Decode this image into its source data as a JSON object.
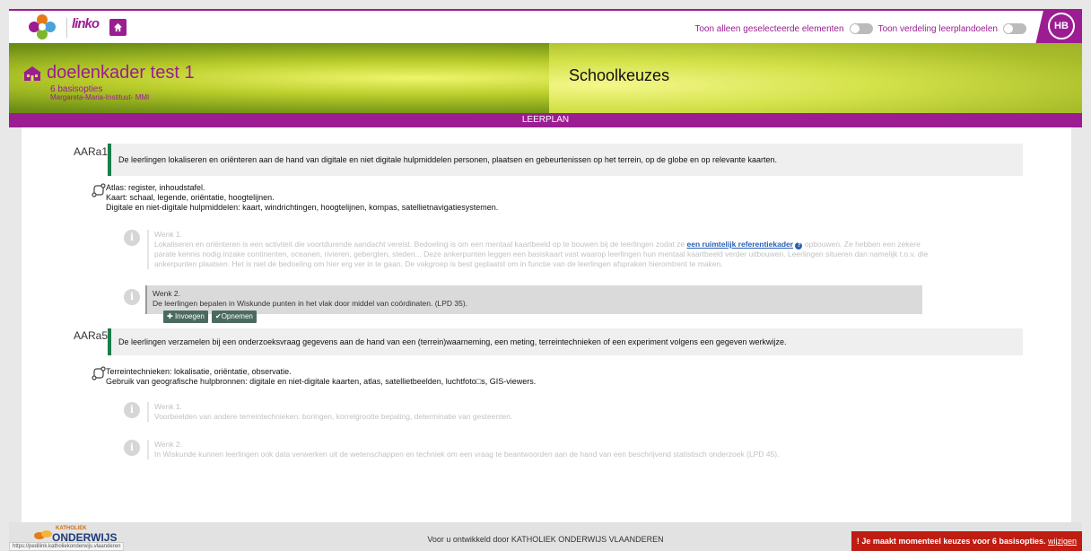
{
  "topbar": {
    "brand": "linko",
    "toggle_selected_label": "Toon alleen geselecteerde elementen",
    "toggle_distribution_label": "Toon verdeling leerplandoelen",
    "avatar_initials": "HB"
  },
  "hero": {
    "title": "doelenkader test 1",
    "subtitle": "6 basisopties",
    "school": "Margareta-Maria-Instituut- MMI",
    "section_title": "Schoolkeuzes"
  },
  "band": {
    "label": "LEERPLAN"
  },
  "goals": [
    {
      "code": "AARa1",
      "text": "De leerlingen lokaliseren en oriënteren aan de hand van digitale en niet digitale hulpmiddelen personen, plaatsen en gebeurtenissen op het terrein, op de globe en op relevante kaarten.",
      "details": [
        "Atlas: register, inhoudstafel.",
        "Kaart: schaal, legende, oriëntatie, hoogtelijnen.",
        "Digitale en niet-digitale hulpmiddelen: kaart, windrichtingen, hoogtelijnen, kompas, satellietnavigatiesystemen."
      ],
      "wenken": [
        {
          "title": "Wenk 1.",
          "text_before": "Lokaliseren en oriënteren is een activiteit die voortdurende aandacht vereist. Bedoeling is om een mentaal kaartbeeld op te bouwen bij de leerlingen zodat ze ",
          "link": "een ruimtelijk referentiekader",
          "text_after": " opbouwen.  Ze hebben een zekere parate kennis nodig inzake continenten, oceanen, rivieren, gebergten, steden... Deze ankerpunten leggen een basiskaart vast waarop leerlingen hun mentaal kaartbeeld verder uitbouwen. Leerlingen situeren dan namelijk t.o.v. die ankerpunten plaatsen. Het is niet de bedoeling om hier erg ver in te gaan. De vakgroep is best geplaatst om in functie van de leerlingen afspraken hieromtrent te maken."
        },
        {
          "title": "Wenk 2.",
          "text": "De leerlingen bepalen in Wiskunde punten in het vlak door middel van coördinaten. (LPD 35)."
        }
      ]
    },
    {
      "code": "AARa5",
      "text": "De leerlingen verzamelen bij een onderzoeksvraag gegevens aan de hand van een (terrein)waarneming, een meting, terreintechnieken of een experiment volgens een gegeven werkwijze.",
      "details": [
        "Terreintechnieken: lokalisatie, oriëntatie, observatie.",
        "Gebruik van geografische hulpbronnen: digitale en niet-digitale kaarten, atlas, satellietbeelden, luchtfoto□s, GIS-viewers."
      ],
      "wenken": [
        {
          "title": "Wenk 1.",
          "text": "Voorbeelden van andere terreintechnieken: boringen, korrelgrootte bepaling, determinatie van gesteenten."
        },
        {
          "title": "Wenk 2.",
          "text": "In Wiskunde kunnen leerlingen ook data verwerken uit de wetenschappen en techniek om een vraag te beantwoorden aan de hand van een beschrijvend statistisch onderzoek (LPD 45)."
        }
      ]
    }
  ],
  "actions": {
    "insert": "Invoegen",
    "adopt": "Opnemen"
  },
  "footer": {
    "logo_top": "KATHOLIEK",
    "logo_bottom": "ONDERWIJS",
    "credit": "Voor u ontwikkeld door KATHOLIEK ONDERWIJS VLAANDEREN",
    "status_url": "https://pedilink.katholiekonderwijs.vlaanderen",
    "warning": "! Je maakt momenteel keuzes voor 6 basisopties.",
    "warning_link": "wijzigen"
  },
  "colors": {
    "brand": "#9b1d91",
    "goal_accent": "#1a7d4a",
    "warning": "#c01d12"
  }
}
